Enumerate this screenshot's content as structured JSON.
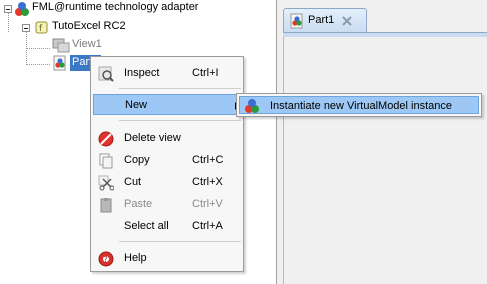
{
  "tree": {
    "root_label": "FML@runtime technology adapter",
    "project_label": "TutoExcel RC2",
    "view1_label": "View1",
    "part1_label": "Part1"
  },
  "editor": {
    "tab_label": "Part1"
  },
  "context_menu": {
    "items": [
      {
        "label": "Inspect",
        "shortcut": "Ctrl+I",
        "icon": "magnifier-icon",
        "enabled": true
      },
      {
        "label": "New",
        "shortcut": "",
        "icon": "",
        "enabled": true,
        "highlighted": true,
        "has_submenu": true
      },
      {
        "label": "Delete view",
        "shortcut": "",
        "icon": "delete-icon",
        "enabled": true
      },
      {
        "label": "Copy",
        "shortcut": "Ctrl+C",
        "icon": "copy-icon",
        "enabled": true
      },
      {
        "label": "Cut",
        "shortcut": "Ctrl+X",
        "icon": "scissors-icon",
        "enabled": true
      },
      {
        "label": "Paste",
        "shortcut": "Ctrl+V",
        "icon": "paste-icon",
        "enabled": false
      },
      {
        "label": "Select all",
        "shortcut": "Ctrl+A",
        "icon": "",
        "enabled": true
      },
      {
        "label": "Help",
        "shortcut": "",
        "icon": "help-icon",
        "enabled": true
      }
    ]
  },
  "submenu": {
    "items": [
      {
        "label": "Instantiate new VirtualModel instance",
        "icon": "virtualmodel-icon",
        "highlighted": true
      }
    ]
  },
  "colors": {
    "highlight": "#9dc8f5",
    "highlight_border": "#6ea4da",
    "tree_selection": "#3c78c8",
    "menu_bg": "#f7f7f7"
  }
}
